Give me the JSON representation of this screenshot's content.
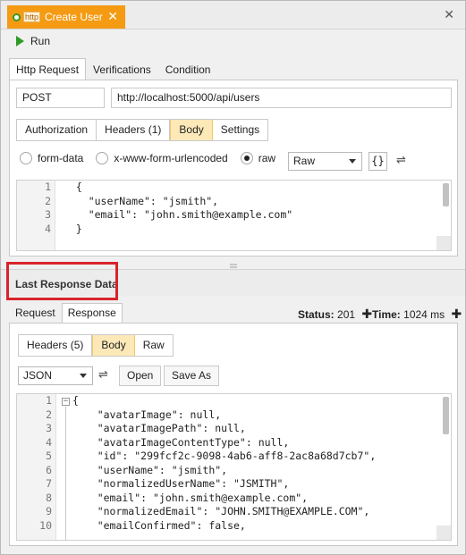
{
  "document_tab": {
    "badge": "http",
    "title": "Create User",
    "close": "✕"
  },
  "window_close": "✕",
  "toolbar": {
    "run_label": "Run"
  },
  "main_tabs": [
    {
      "label": "Http Request"
    },
    {
      "label": "Verifications"
    },
    {
      "label": "Condition"
    }
  ],
  "request": {
    "method": "POST",
    "url": "http://localhost:5000/api/users",
    "subtabs": [
      {
        "label": "Authorization"
      },
      {
        "label": "Headers (1)"
      },
      {
        "label": "Body"
      },
      {
        "label": "Settings"
      }
    ],
    "body_types": [
      {
        "label": "form-data"
      },
      {
        "label": "x-www-form-urlencoded"
      },
      {
        "label": "raw"
      }
    ],
    "format": "Raw",
    "format_icon": "{}",
    "body_lines": [
      {
        "n": "1",
        "text": "  {"
      },
      {
        "n": "2",
        "text": "    \"userName\": \"jsmith\","
      },
      {
        "n": "3",
        "text": "    \"email\": \"john.smith@example.com\""
      },
      {
        "n": "4",
        "text": "  }"
      }
    ]
  },
  "last_response": {
    "title": "Last Response Data",
    "tabs": [
      {
        "label": "Request"
      },
      {
        "label": "Response"
      }
    ],
    "status_label": "Status:",
    "status_value": "201",
    "time_label": "Time:",
    "time_value": "1024 ms",
    "plus": "✚",
    "subtabs": [
      {
        "label": "Headers (5)"
      },
      {
        "label": "Body"
      },
      {
        "label": "Raw"
      }
    ],
    "format": "JSON",
    "open_label": "Open",
    "save_as_label": "Save As",
    "body_lines": [
      {
        "n": "1",
        "text": "{"
      },
      {
        "n": "2",
        "text": "    \"avatarImage\": null,"
      },
      {
        "n": "3",
        "text": "    \"avatarImagePath\": null,"
      },
      {
        "n": "4",
        "text": "    \"avatarImageContentType\": null,"
      },
      {
        "n": "5",
        "text": "    \"id\": \"299fcf2c-9098-4ab6-aff8-2ac8a68d7cb7\","
      },
      {
        "n": "6",
        "text": "    \"userName\": \"jsmith\","
      },
      {
        "n": "7",
        "text": "    \"normalizedUserName\": \"JSMITH\","
      },
      {
        "n": "8",
        "text": "    \"email\": \"john.smith@example.com\","
      },
      {
        "n": "9",
        "text": "    \"normalizedEmail\": \"JOHN.SMITH@EXAMPLE.COM\","
      },
      {
        "n": "10",
        "text": "    \"emailConfirmed\": false,"
      }
    ]
  }
}
